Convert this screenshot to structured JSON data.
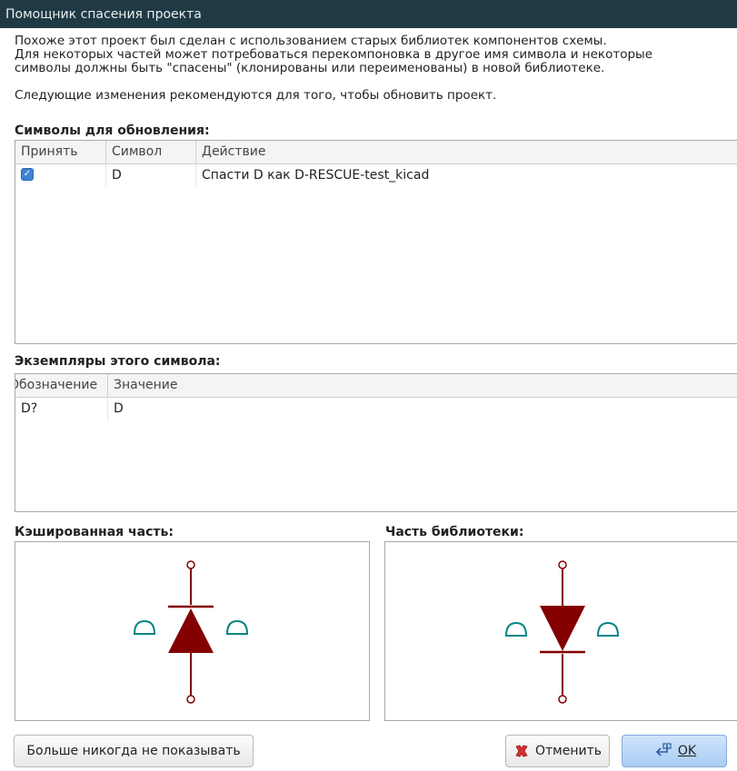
{
  "window": {
    "title": "Помощник спасения проекта"
  },
  "intro": {
    "line1": "Похоже этот проект был сделан с использованием старых библиотек компонентов схемы.",
    "line2": "Для некоторых частей может потребоваться перекомпоновка в другое имя символа и некоторые",
    "line3": "символы должны быть \"спасены\" (клонированы или переименованы) в новой библиотеке.",
    "line4": "Следующие изменения рекомендуются для того, чтобы обновить проект."
  },
  "symbols": {
    "label": "Символы для обновления:",
    "columns": [
      "Принять",
      "Символ",
      "Действие"
    ],
    "rows": [
      {
        "accept": true,
        "symbol": "D",
        "action": "Спасти D как D-RESCUE-test_kicad"
      }
    ]
  },
  "instances": {
    "label": "Экземпляры этого символа:",
    "columns": [
      "Обозначение",
      "Значение"
    ],
    "rows": [
      {
        "reference": "D?",
        "value": "D"
      }
    ]
  },
  "previews": {
    "cached_label": "Кэшированная часть:",
    "library_label": "Часть библиотеки:"
  },
  "colors": {
    "symbol_body": "#840000",
    "pin_text": "#008484"
  },
  "buttons": {
    "never_show": "Больше никогда не показывать",
    "cancel": "Отменить",
    "ok": "OK"
  }
}
